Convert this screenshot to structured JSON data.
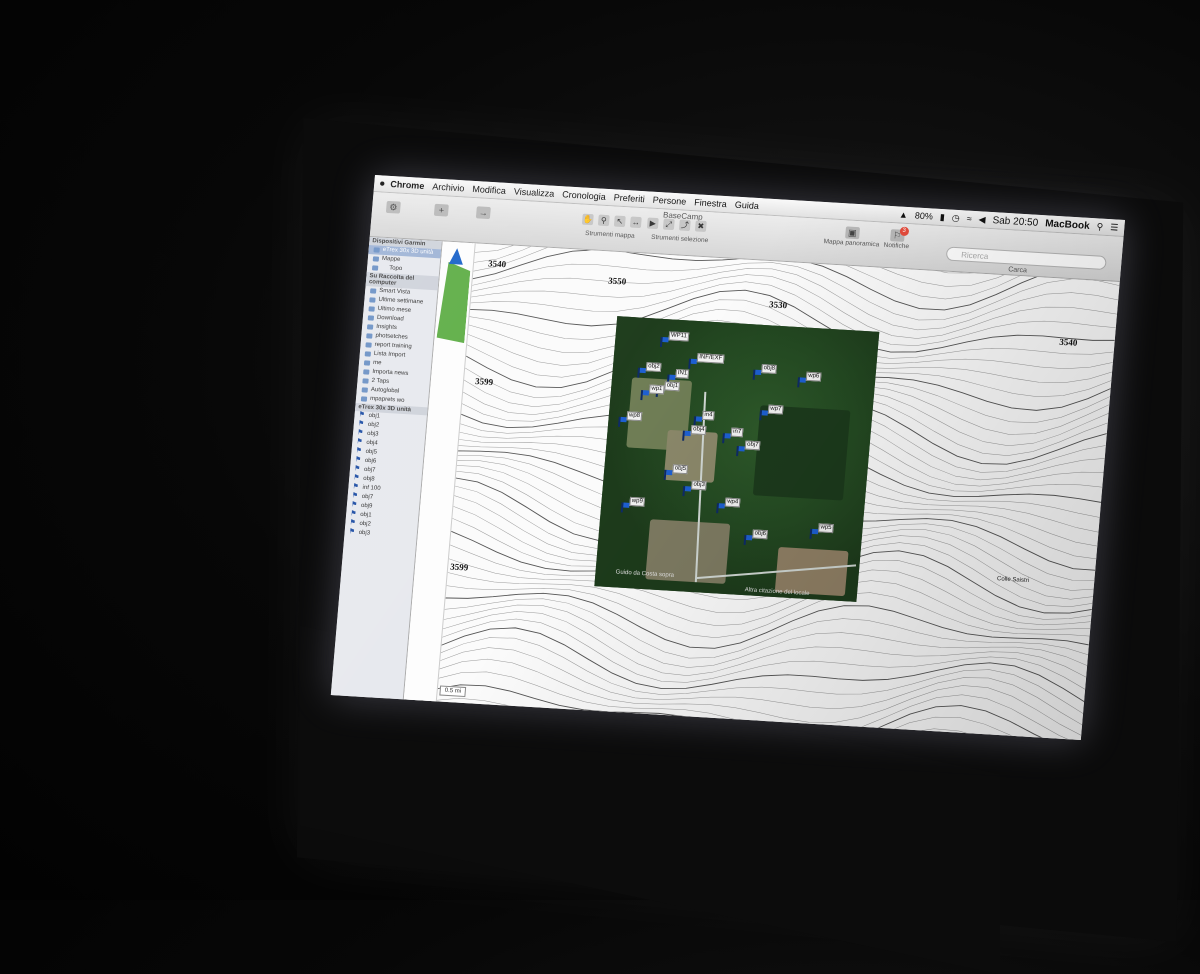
{
  "menubar": {
    "apple": "",
    "app_name": "Chrome",
    "items": [
      "Archivio",
      "Modifica",
      "Visualizza",
      "Cronologia",
      "Preferiti",
      "Persone",
      "Finestra",
      "Guida"
    ],
    "battery": "80%",
    "clock": "Sab 20:50",
    "machine": "MacBook"
  },
  "toolbar": {
    "window_title": "BaseCamp",
    "map_tools_label": "Strumenti mappa",
    "selection_tools_label": "Strumenti selezione",
    "overview_label": "Mappa panoramica",
    "notifications_label": "Notifiche",
    "notifications_count": "3",
    "search_placeholder": "Ricerca",
    "search_caption": "Carca"
  },
  "sidebar": {
    "device_header": "Dispositivi Garmin",
    "device_name": "eTrex 30x 3D unità",
    "maps_label": "Mappe",
    "maps_child": "Topo",
    "library_header": "Su Raccolta del computer",
    "library_items": [
      "Smart Vista",
      "Ultime settimane",
      "Ultimo mese",
      "Download",
      "Insights",
      "photsetches",
      "report training",
      "Lista Import",
      "me",
      "Importa news",
      "2 Taps",
      "Autoglobal",
      "mpaprets wo"
    ],
    "waypoints_header": "eTrex 30x 3D unità",
    "waypoint_rows": [
      "obj1",
      "obj2",
      "obj3",
      "obj4",
      "obj5",
      "obj6",
      "obj7",
      "obj8",
      "inf 100",
      "obj7",
      "obj9",
      "obj1",
      "obj2",
      "obj3"
    ]
  },
  "map": {
    "elevations": [
      "3540",
      "3550",
      "3530",
      "3540",
      "3599",
      "3599"
    ],
    "place_label": "Colle Saistri",
    "scale": "0.5 mi",
    "sat_caption_left": "Guido da Costa sopra",
    "sat_caption_right": "Altra citazione del locale"
  },
  "waypoints": [
    "WP11",
    "INF/EXF",
    "obj8",
    "wp6",
    "obj2",
    "IN1",
    "obj1",
    "wp1",
    "wp7",
    "in4",
    "wp8",
    "obj4",
    "in7",
    "obj7",
    "obj5",
    "obj3",
    "wp4",
    "wp9",
    "obj6",
    "wp5"
  ],
  "colors": {
    "flag": "#1d5fd1",
    "badge": "#e74c3c",
    "sidebar_selected": "#9fb4d6"
  }
}
